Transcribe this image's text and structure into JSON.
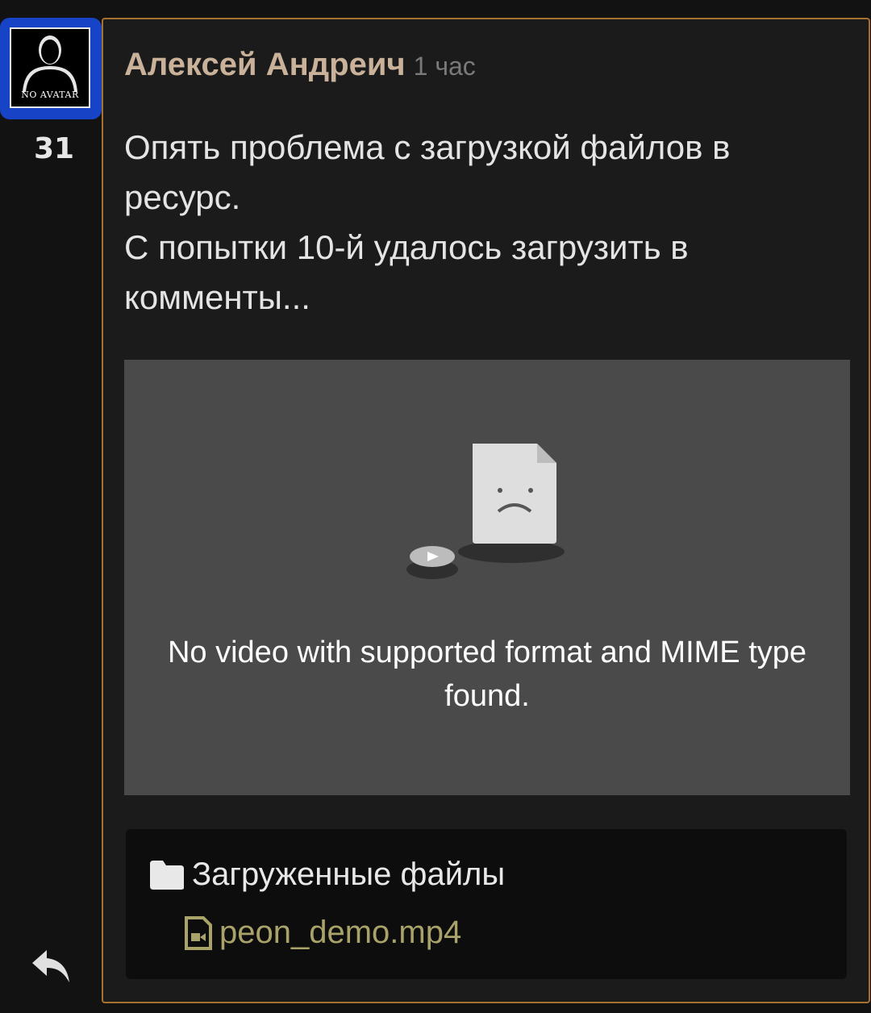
{
  "avatar": {
    "label": "NO AVATAR"
  },
  "rating": "31",
  "comment": {
    "author": "Алексей Андреич",
    "time": "1 час",
    "lines": [
      "Опять проблема с загрузкой файлов в ресурс.",
      "С попытки 10-й удалось загрузить в комменты..."
    ]
  },
  "video": {
    "message": "No video with supported format and MIME type found."
  },
  "files": {
    "title": "Загруженные файлы",
    "items": [
      "peon_demo.mp4"
    ]
  },
  "icons": [
    "user-silhouette-icon",
    "sad-file-icon",
    "play-disc-icon",
    "folder-icon",
    "video-file-icon",
    "reply-icon"
  ],
  "colors": {
    "author": "#c9b299",
    "border": "#a8702e",
    "avatar_frame": "#1743c7",
    "file_link": "#a9a36a"
  }
}
